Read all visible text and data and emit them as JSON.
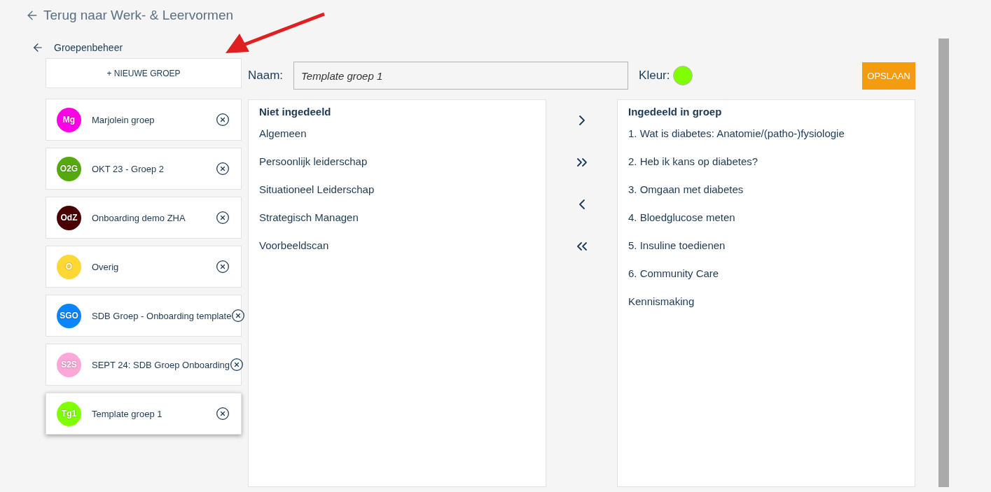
{
  "back_link": {
    "label": "Terug naar Werk- & Leervormen"
  },
  "section": {
    "title": "Groepenbeheer"
  },
  "new_group_button": "+ NIEUWE GROEP",
  "groups": [
    {
      "initials": "Mg",
      "name": "Marjolein groep",
      "color": "#ff00e6",
      "selected": false
    },
    {
      "initials": "O2G",
      "name": "OKT 23 - Groep 2",
      "color": "#55a90f",
      "selected": false
    },
    {
      "initials": "OdZ",
      "name": "Onboarding demo ZHA",
      "color": "#4a0000",
      "selected": false
    },
    {
      "initials": "O",
      "name": "Overig",
      "color": "#fdd835",
      "selected": false
    },
    {
      "initials": "SGO",
      "name": "SDB Groep - Onboarding template",
      "color": "#0a84ff",
      "selected": false
    },
    {
      "initials": "S2S",
      "name": "SEPT 24: SDB Groep Onboarding",
      "color": "#fba8d8",
      "selected": false
    },
    {
      "initials": "Tg1",
      "name": "Template groep 1",
      "color": "#80ff00",
      "selected": true
    }
  ],
  "form": {
    "name_label": "Naam:",
    "name_value": "Template groep 1",
    "color_label": "Kleur:",
    "color": "#80ff00",
    "save_button": "OPSLAAN"
  },
  "unassigned": {
    "title": "Niet ingedeeld",
    "items": [
      "Algemeen",
      "Persoonlijk leiderschap",
      "Situationeel Leiderschap",
      "Strategisch Managen",
      "Voorbeeldscan"
    ]
  },
  "assigned": {
    "title": "Ingedeeld in groep",
    "items": [
      "1. Wat is diabetes: Anatomie/(patho-)fysiologie",
      "2. Heb ik kans op diabetes?",
      "3. Omgaan met diabetes",
      "4. Bloedglucose meten",
      "5. Insuline toedienen",
      "6. Community Care",
      "Kennismaking"
    ]
  }
}
